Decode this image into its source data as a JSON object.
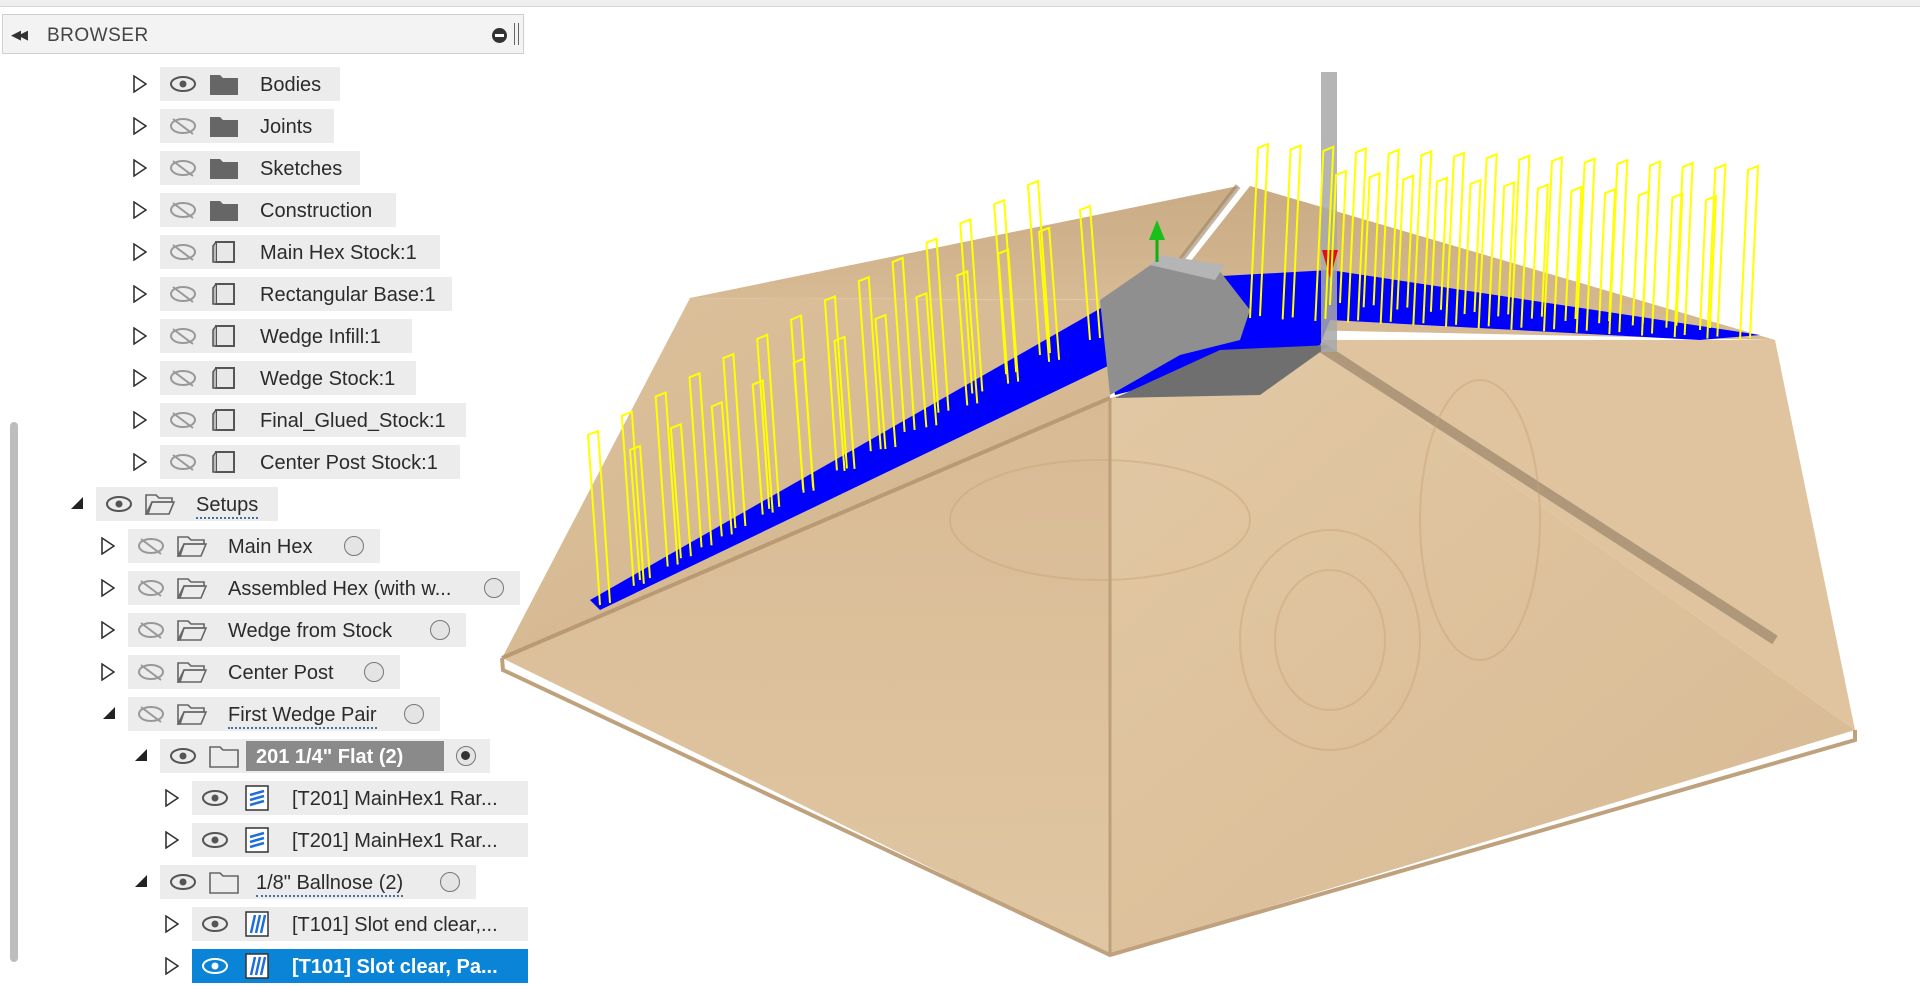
{
  "browser": {
    "title": "BROWSER",
    "collapse_icon": "double-chevron-left-icon",
    "minimize_icon": "minus-circle-icon"
  },
  "tree": {
    "bodies": "Bodies",
    "joints": "Joints",
    "sketches": "Sketches",
    "construction": "Construction",
    "main_hex_stock": "Main Hex Stock:1",
    "rectangular_base": "Rectangular Base:1",
    "wedge_infill": "Wedge Infill:1",
    "wedge_stock": "Wedge Stock:1",
    "final_glued_stock": "Final_Glued_Stock:1",
    "center_post_stock": "Center Post Stock:1",
    "setups": "Setups",
    "main_hex": "Main Hex",
    "assembled_hex": "Assembled Hex (with w...",
    "wedge_from_stock": "Wedge from Stock",
    "center_post": "Center Post",
    "first_wedge_pair": "First Wedge Pair",
    "tool_201": "201 1/4\" Flat (2)",
    "op_t201_a": "[T201] MainHex1 Rar...",
    "op_t201_b": "[T201] MainHex1 Rar...",
    "tool_ballnose": "1/8\" Ballnose (2)",
    "op_t101_a": "[T101] Slot end clear,...",
    "op_t101_b": "[T101] Slot clear, Pa..."
  },
  "colors": {
    "toolpath": "#ffff00",
    "cut_region": "#0000ff",
    "selection": "#0a84d6",
    "wood": "#d9bd96"
  }
}
